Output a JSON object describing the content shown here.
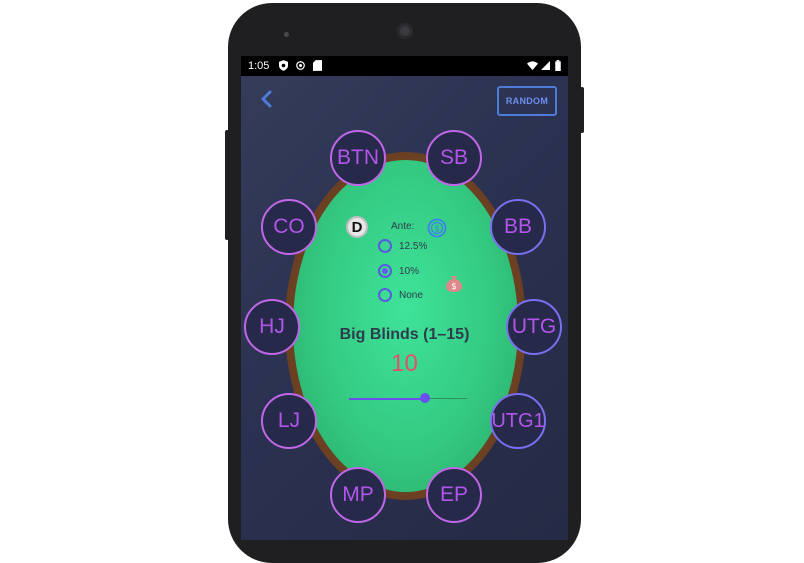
{
  "status_bar": {
    "time": "1:05"
  },
  "header": {
    "random_label": "RANDOM"
  },
  "seats": [
    "BTN",
    "SB",
    "BB",
    "UTG",
    "UTG1",
    "EP",
    "MP",
    "LJ",
    "HJ",
    "CO"
  ],
  "dealer": {
    "label": "D"
  },
  "ante": {
    "label": "Ante:",
    "options": [
      {
        "label": "12.5%",
        "selected": false
      },
      {
        "label": "10%",
        "selected": true
      },
      {
        "label": "None",
        "selected": false
      }
    ]
  },
  "big_blinds": {
    "title": "Big Blinds (1–15)",
    "value": "10",
    "min": 1,
    "max": 15
  },
  "colors": {
    "accent": "#6a4ef0",
    "seat_text": "#b355ea",
    "value": "#e0506a",
    "felt": "#34c981"
  },
  "icons": [
    "back-arrow-icon",
    "dollar-coin-icon",
    "money-bag-icon",
    "shield-icon",
    "sync-icon",
    "sd-card-icon",
    "wifi-icon",
    "signal-icon",
    "battery-icon"
  ]
}
